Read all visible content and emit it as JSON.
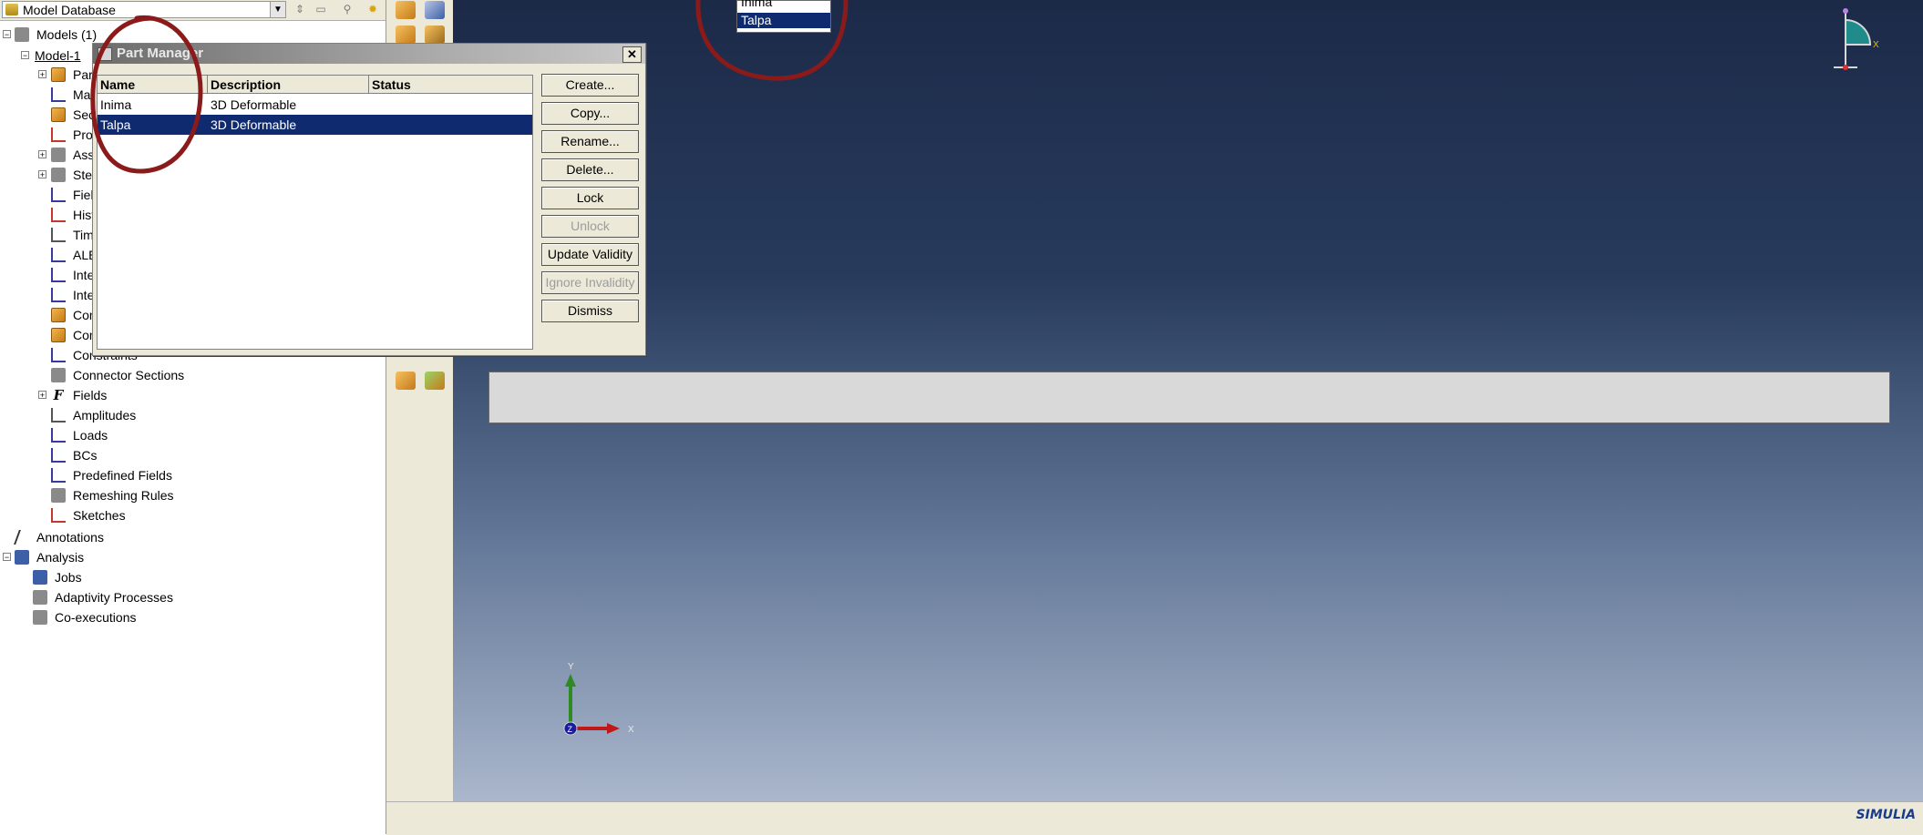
{
  "db_bar": {
    "selector_label": "Model Database"
  },
  "tree": {
    "root_label": "Models (1)",
    "model_label": "Model-1",
    "items": [
      {
        "label": "Parts",
        "icon": "parts-icon"
      },
      {
        "label": "Materials",
        "icon": "materials-icon"
      },
      {
        "label": "Sections",
        "icon": "sections-icon"
      },
      {
        "label": "Profiles",
        "icon": "profiles-icon"
      },
      {
        "label": "Assembly",
        "icon": "assembly-icon"
      },
      {
        "label": "Steps",
        "icon": "steps-icon"
      },
      {
        "label": "Field Output Requests",
        "icon": "field-output-icon"
      },
      {
        "label": "History Output Requests",
        "icon": "history-output-icon"
      },
      {
        "label": "Time Points",
        "icon": "time-points-icon"
      },
      {
        "label": "ALE Adaptive Mesh Constraints",
        "icon": "ale-icon"
      },
      {
        "label": "Interactions",
        "icon": "interactions-icon"
      },
      {
        "label": "Interaction Properties",
        "icon": "interaction-properties-icon"
      },
      {
        "label": "Contact Controls",
        "icon": "contact-controls-icon"
      },
      {
        "label": "Contact Initializations",
        "icon": "contact-initializations-icon"
      },
      {
        "label": "Constraints",
        "icon": "constraints-icon"
      },
      {
        "label": "Connector Sections",
        "icon": "connector-sections-icon"
      },
      {
        "label": "Fields",
        "icon": "fields-icon"
      },
      {
        "label": "Amplitudes",
        "icon": "amplitudes-icon"
      },
      {
        "label": "Loads",
        "icon": "loads-icon"
      },
      {
        "label": "BCs",
        "icon": "bcs-icon"
      },
      {
        "label": "Predefined Fields",
        "icon": "predefined-fields-icon"
      },
      {
        "label": "Remeshing Rules",
        "icon": "remeshing-rules-icon"
      },
      {
        "label": "Sketches",
        "icon": "sketches-icon"
      }
    ],
    "annotations_label": "Annotations",
    "analysis_label": "Analysis",
    "analysis_items": [
      {
        "label": "Jobs",
        "icon": "jobs-icon"
      },
      {
        "label": "Adaptivity Processes",
        "icon": "adaptivity-icon"
      },
      {
        "label": "Co-executions",
        "icon": "co-executions-icon"
      }
    ]
  },
  "top_list": {
    "items": [
      "Inima",
      "Talpa"
    ],
    "selected": "Talpa"
  },
  "part_manager": {
    "title": "Part Manager",
    "columns": [
      "Name",
      "Description",
      "Status"
    ],
    "rows": [
      {
        "name": "Inima",
        "description": "3D Deformable",
        "status": ""
      },
      {
        "name": "Talpa",
        "description": "3D Deformable",
        "status": ""
      }
    ],
    "selected_row": "Talpa",
    "buttons": {
      "create": "Create...",
      "copy": "Copy...",
      "rename": "Rename...",
      "delete": "Delete...",
      "lock": "Lock",
      "unlock": "Unlock",
      "update_validity": "Update Validity",
      "ignore_invalidity": "Ignore Invalidity",
      "dismiss": "Dismiss"
    },
    "close_glyph": "✕"
  },
  "triad": {
    "y": "Y",
    "z": "Z",
    "x": "X"
  },
  "view_cube": {
    "x": "X"
  },
  "status_bar": {
    "logo": "SIMULIA"
  },
  "colors": {
    "selection": "#0f2a6e",
    "annotation_circle": "#8b1a1a",
    "triad_y": "#2e8b22",
    "triad_x": "#c01818",
    "triad_z": "#1a1a9a"
  }
}
